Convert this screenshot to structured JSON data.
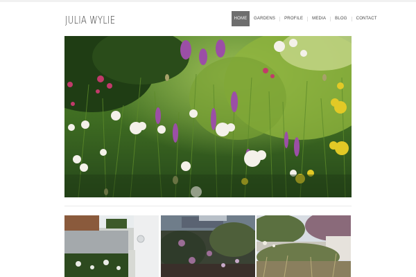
{
  "site": {
    "logo_text": "JULIA WYLIE"
  },
  "nav": {
    "items": [
      {
        "label": "HOME",
        "active": true
      },
      {
        "label": "GARDENS",
        "active": false
      },
      {
        "label": "PROFILE",
        "active": false
      },
      {
        "label": "MEDIA",
        "active": false
      },
      {
        "label": "BLOG",
        "active": false
      },
      {
        "label": "CONTACT",
        "active": false
      }
    ]
  },
  "colors": {
    "nav_active_bg": "#6e6e6e",
    "page_bg": "#ffffff",
    "text": "#333333"
  },
  "gallery": {
    "items": [
      "garden-photo",
      "garden-photo",
      "garden-photo"
    ]
  }
}
